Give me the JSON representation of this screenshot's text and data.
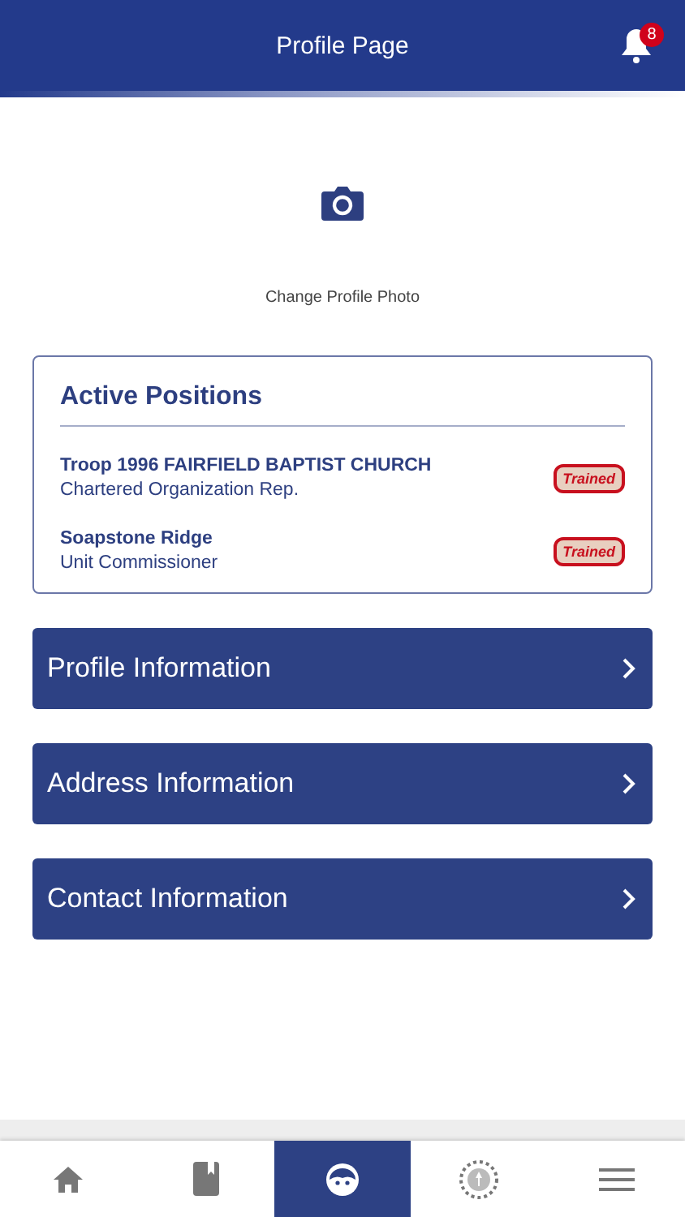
{
  "header": {
    "title": "Profile Page",
    "notification_count": "8"
  },
  "photo": {
    "label": "Change Profile Photo"
  },
  "positions": {
    "title": "Active Positions",
    "items": [
      {
        "unit": "Troop 1996 FAIRFIELD BAPTIST CHURCH",
        "role": "Chartered Organization Rep.",
        "badge": "Trained"
      },
      {
        "unit": "Soapstone Ridge",
        "role": "Unit Commissioner",
        "badge": "Trained"
      }
    ]
  },
  "sections": [
    {
      "label": "Profile Information"
    },
    {
      "label": "Address Information"
    },
    {
      "label": "Contact Information"
    }
  ],
  "tabs": [
    {
      "kind": "home",
      "selected": false
    },
    {
      "kind": "book",
      "selected": false
    },
    {
      "kind": "profile",
      "selected": true
    },
    {
      "kind": "emblem",
      "selected": false
    },
    {
      "kind": "menu",
      "selected": false
    }
  ]
}
